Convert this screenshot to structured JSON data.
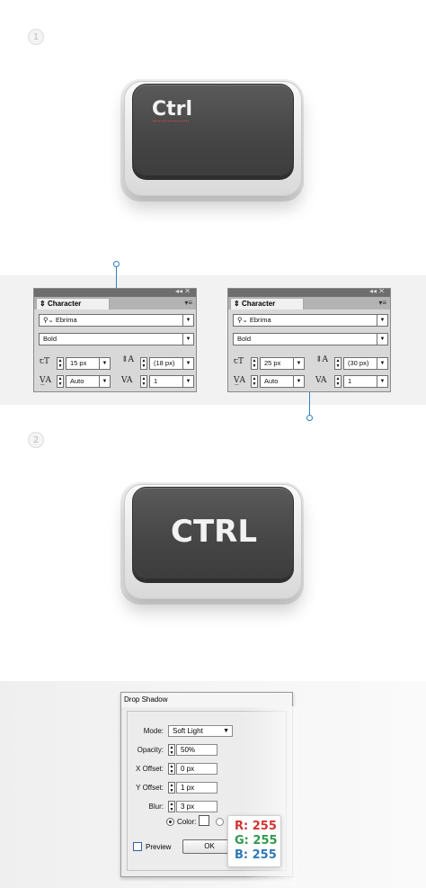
{
  "steps": {
    "one": "1",
    "two": "2"
  },
  "key1": {
    "label": "Ctrl"
  },
  "key2": {
    "label": "CTRL"
  },
  "panel_left": {
    "title": "Character",
    "collapse": "◂◂ ✕",
    "menu": "▾≡",
    "font_family": "Ebrima",
    "font_style": "Bold",
    "size": "15 px",
    "leading": "(18 px)",
    "kerning": "Auto",
    "tracking": "1"
  },
  "panel_right": {
    "title": "Character",
    "collapse": "◂◂ ✕",
    "menu": "▾≡",
    "font_family": "Ebrima",
    "font_style": "Bold",
    "size": "25 px",
    "leading": "(30 px)",
    "kerning": "Auto",
    "tracking": "1"
  },
  "drop_shadow": {
    "title": "Drop Shadow",
    "mode_label": "Mode:",
    "mode_value": "Soft Light",
    "opacity_label": "Opacity:",
    "opacity_value": "50%",
    "x_offset_label": "X Offset:",
    "x_offset_value": "0 px",
    "y_offset_label": "Y Offset:",
    "y_offset_value": "1 px",
    "blur_label": "Blur:",
    "blur_value": "3 px",
    "color_label": "Color:",
    "preview_label": "Preview",
    "ok_label": "OK"
  },
  "rgb": {
    "r": "R: 255",
    "g": "G: 255",
    "b": "B: 255"
  },
  "colors": {
    "accent_line": "#2f7fc1",
    "r": "#d23232",
    "g": "#2f9a4c",
    "b": "#2f78b8"
  }
}
